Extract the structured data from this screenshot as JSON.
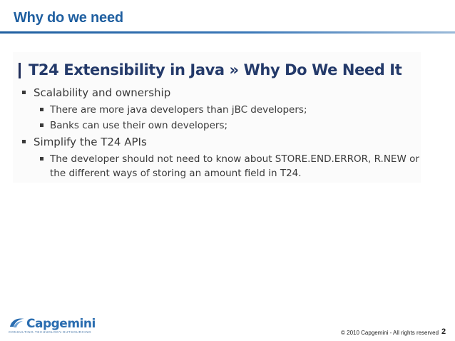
{
  "slide": {
    "title": "Why do we need",
    "heading": "T24 Extensibility in Java » Why Do We Need It",
    "bullets": [
      {
        "level": 1,
        "text": "Scalability and ownership"
      },
      {
        "level": 2,
        "text": "There are more java developers than jBC developers;"
      },
      {
        "level": 2,
        "text": "Banks can use their own developers;"
      },
      {
        "level": 1,
        "text": "Simplify the T24 APIs"
      },
      {
        "level": 2,
        "text": "The developer should not need to know about STORE.END.ERROR, R.NEW or"
      },
      {
        "level": 2,
        "text": "the different ways of storing an amount field in T24."
      }
    ]
  },
  "footer": {
    "logo_word": "Capgemini",
    "logo_tagline": "CONSULTING.TECHNOLOGY.OUTSOURCING",
    "copyright": "© 2010 Capgemini - All rights reserved",
    "page_number": "2"
  },
  "colors": {
    "title_blue": "#1f5fa0",
    "heading_navy": "#243a6a",
    "body_text": "#3a3a3a"
  },
  "icons": [
    "capgemini-logo-icon",
    "bullet-square-icon"
  ]
}
